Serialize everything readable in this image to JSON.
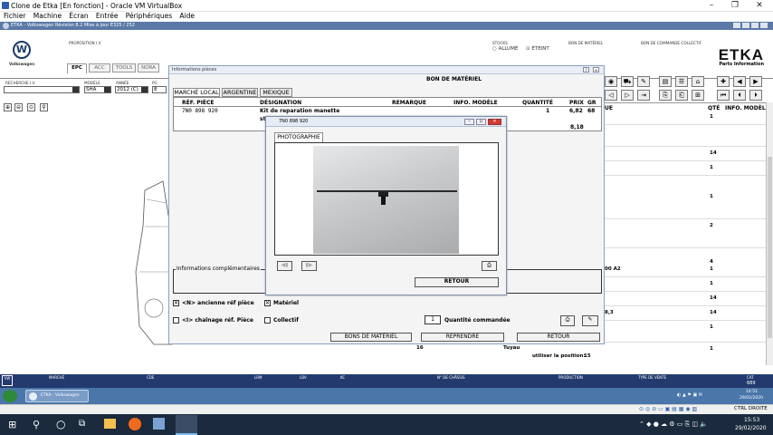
{
  "vbox": {
    "title": "Clone de Etka [En fonction] - Oracle VM VirtualBox",
    "menu": [
      "Fichier",
      "Machine",
      "Écran",
      "Entrée",
      "Périphériques",
      "Aide"
    ]
  },
  "guest": {
    "title": "ETKA - Volkswagen Révision 8.2 Mise à jour E325 / 252"
  },
  "header": {
    "brand": "Volkswagen",
    "proposition": "PROPOSITION I.V.",
    "tabs": [
      "EPC",
      "ACC",
      "TOOLS",
      "NORA"
    ],
    "stocks_label": "STOCKS",
    "stocks_on": "ALLUMÉ",
    "stocks_off": "ÉTEINT",
    "bon_materiel": "BON DE MATÉRIEL",
    "bon_commande": "BON DE COMMANDE COLLECTIF",
    "etka": "ETKA",
    "etka_sub": "Parts Information",
    "recherche": "RECHERCHE I.V.",
    "modele_label": "MODÈLE",
    "annee_label": "ANNÉE",
    "pg_label": "PG",
    "modele": "SHA",
    "annee": "2012 (C)",
    "pg": "8"
  },
  "right_panel": {
    "col_remarque": "UE",
    "col_qte": "QTÉ",
    "col_info": "INFO. MODÈLE",
    "qtys": [
      "1",
      "14",
      "1",
      "1",
      "2",
      "4",
      "1",
      "1",
      "14",
      "14",
      "1",
      "1"
    ],
    "side_text1": "00 A2",
    "side_text2": "8,3"
  },
  "info_dialog": {
    "title": "Informations pièces",
    "subtitle": "BON DE MATÉRIEL",
    "tabs": [
      "MARCHÉ LOCAL",
      "ARGENTINE",
      "MEXIQUE"
    ],
    "columns": [
      "RÉF. PIÈCE",
      "DÉSIGNATION",
      "REMARQUE",
      "INFO. MODÈLE",
      "QUANTITÉ",
      "PRIX",
      "GR"
    ],
    "row": {
      "ref": "7N0 898 920",
      "designation": "Kit de reparation manette",
      "designation2": "sto",
      "quantite": "1",
      "prix": "6,82",
      "gr": "68",
      "total": "8,18"
    },
    "complementary": "Informations complémentaires",
    "chk_old_ref": "<N> ancienne réf pièce",
    "chk_materiel": "Matériel",
    "chk_chainage": "<I> chaînage réf. Pièce",
    "chk_collectif": "Collectif",
    "qty_value": "1",
    "qty_label": "Quantité commandée",
    "btn_bons": "BONS DE MATÉRIEL",
    "btn_reprendre": "REPRENDRE",
    "btn_retour": "RETOUR",
    "footer_num": "16",
    "footer_text": "Tuyau",
    "footer_use": "utiliser la position:",
    "footer_pos": "15"
  },
  "photo_dialog": {
    "title": "7N0 898 920",
    "tab": "PHOTOGRAPHIE",
    "btn_retour": "RETOUR"
  },
  "status_bar": {
    "marche": "MARCHÉ",
    "cde": "CDE",
    "lrm": "LRM",
    "lbv": "LBV",
    "kc": "KC",
    "chassis": "N° DE CHÂSSIS",
    "production": "PRODUCTION",
    "vente": "TYPE DE VENTE",
    "cat": "CAT",
    "cat_val": "689"
  },
  "guest_taskbar": {
    "app": "ETKA - Volkswagen",
    "time": "14:51",
    "date": "29/02/2020"
  },
  "vb_status": {
    "host_key": "CTRL DROITE"
  },
  "windows_taskbar": {
    "time": "15:53",
    "date": "29/02/2020"
  }
}
